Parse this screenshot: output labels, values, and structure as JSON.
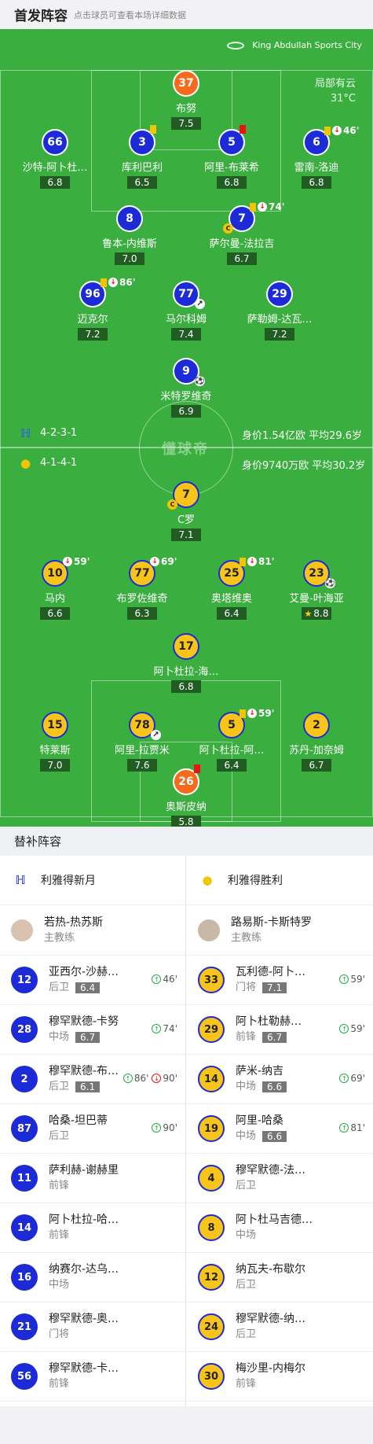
{
  "header": {
    "title": "首发阵容",
    "hint": "点击球员可查看本场详细数据"
  },
  "pitch": {
    "venue": "King Abdullah Sports City",
    "weather": "局部有云",
    "temp": "31°C",
    "watermark": "懂球帝"
  },
  "home_info": {
    "formation": "4-2-3-1",
    "value": "身价1.54亿欧",
    "age": "平均29.6岁"
  },
  "away_info": {
    "formation": "4-1-4-1",
    "value": "身价9740万欧",
    "age": "平均30.2岁"
  },
  "home": {
    "gk": {
      "num": "37",
      "name": "布努",
      "rating": "7.5"
    },
    "d1": {
      "num": "66",
      "name": "沙特-阿卜杜…",
      "rating": "6.8"
    },
    "d2": {
      "num": "3",
      "name": "库利巴利",
      "rating": "6.5"
    },
    "d3": {
      "num": "5",
      "name": "阿里-布莱希",
      "rating": "6.8"
    },
    "d4": {
      "num": "6",
      "name": "雷南-洛迪",
      "rating": "6.8",
      "min": "46'"
    },
    "m1": {
      "num": "8",
      "name": "鲁本-内维斯",
      "rating": "7.0"
    },
    "m2": {
      "num": "7",
      "name": "萨尔曼-法拉吉",
      "rating": "6.7",
      "min": "74'"
    },
    "a1": {
      "num": "96",
      "name": "迈克尔",
      "rating": "7.2",
      "min": "86'"
    },
    "a2": {
      "num": "77",
      "name": "马尔科姆",
      "rating": "7.4"
    },
    "a3": {
      "num": "29",
      "name": "萨勒姆-达瓦…",
      "rating": "7.2"
    },
    "f1": {
      "num": "9",
      "name": "米特罗维奇",
      "rating": "6.9"
    }
  },
  "away": {
    "f1": {
      "num": "7",
      "name": "C罗",
      "rating": "7.1"
    },
    "m1": {
      "num": "10",
      "name": "马内",
      "rating": "6.6",
      "min": "59'"
    },
    "m2": {
      "num": "77",
      "name": "布罗佐维奇",
      "rating": "6.3",
      "min": "69'"
    },
    "m3": {
      "num": "25",
      "name": "奥塔维奥",
      "rating": "6.4",
      "min": "81'"
    },
    "m4": {
      "num": "23",
      "name": "艾曼-叶海亚",
      "rating": "8.8"
    },
    "dm": {
      "num": "17",
      "name": "阿卜杜拉-海…",
      "rating": "6.8"
    },
    "d1": {
      "num": "15",
      "name": "特莱斯",
      "rating": "7.0"
    },
    "d2": {
      "num": "78",
      "name": "阿里-拉贾米",
      "rating": "7.6"
    },
    "d3": {
      "num": "5",
      "name": "阿卜杜拉-阿…",
      "rating": "6.4",
      "min": "59'"
    },
    "d4": {
      "num": "2",
      "name": "苏丹-加奈姆",
      "rating": "6.7"
    },
    "gk": {
      "num": "26",
      "name": "奥斯皮纳",
      "rating": "5.8"
    }
  },
  "subs": {
    "title": "替补阵容",
    "home_team": "利雅得新月",
    "away_team": "利雅得胜利",
    "home_coach": {
      "name": "若热-热苏斯",
      "role": "主教练"
    },
    "away_coach": {
      "name": "路易斯-卡斯特罗",
      "role": "主教练"
    },
    "home_list": [
      {
        "num": "12",
        "name": "亚西尔-沙赫…",
        "pos": "后卫",
        "rating": "6.4",
        "in": "46'"
      },
      {
        "num": "28",
        "name": "穆罕默德-卡努",
        "pos": "中场",
        "rating": "6.7",
        "in": "74'"
      },
      {
        "num": "2",
        "name": "穆罕默德-布…",
        "pos": "后卫",
        "rating": "6.1",
        "in": "86'",
        "out": "90'"
      },
      {
        "num": "87",
        "name": "哈桑-坦巴蒂",
        "pos": "后卫",
        "in": "90'"
      },
      {
        "num": "11",
        "name": "萨利赫-谢赫里",
        "pos": "前锋"
      },
      {
        "num": "14",
        "name": "阿卜杜拉-哈…",
        "pos": "前锋"
      },
      {
        "num": "16",
        "name": "纳赛尔-达乌…",
        "pos": "中场"
      },
      {
        "num": "21",
        "name": "穆罕默德-奥…",
        "pos": "门将"
      },
      {
        "num": "56",
        "name": "穆罕默德-卡…",
        "pos": "前锋"
      }
    ],
    "away_list": [
      {
        "num": "33",
        "name": "瓦利德-阿卜…",
        "pos": "门将",
        "rating": "7.1",
        "in": "59'"
      },
      {
        "num": "29",
        "name": "阿卜杜勒赫…",
        "pos": "前锋",
        "rating": "6.7",
        "in": "59'"
      },
      {
        "num": "14",
        "name": "萨米-纳吉",
        "pos": "中场",
        "rating": "6.6",
        "in": "69'"
      },
      {
        "num": "19",
        "name": "阿里-哈桑",
        "pos": "中场",
        "rating": "6.6",
        "in": "81'"
      },
      {
        "num": "4",
        "name": "穆罕默德-法…",
        "pos": "后卫"
      },
      {
        "num": "8",
        "name": "阿卜杜马吉德…",
        "pos": "中场"
      },
      {
        "num": "12",
        "name": "纳瓦夫-布歇尔",
        "pos": "后卫"
      },
      {
        "num": "24",
        "name": "穆罕默德-纳…",
        "pos": "后卫"
      },
      {
        "num": "30",
        "name": "梅沙里-内梅尔",
        "pos": "前锋"
      }
    ]
  }
}
